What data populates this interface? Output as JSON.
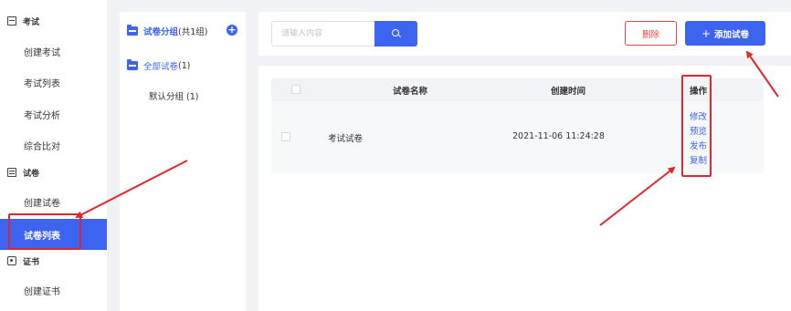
{
  "sidebar": {
    "sections": [
      {
        "title": "考试",
        "icon": "exam-icon",
        "items": [
          "创建考试",
          "考试列表",
          "考试分析",
          "综合比对"
        ]
      },
      {
        "title": "试卷",
        "icon": "paper-icon",
        "items": [
          "创建试卷",
          "试卷列表"
        ]
      },
      {
        "title": "证书",
        "icon": "certificate-icon",
        "items": [
          "创建证书"
        ]
      }
    ],
    "active_item": "试卷列表"
  },
  "groups": {
    "header_label": "试卷分组",
    "header_count": "(共1组)",
    "all_label": "全部试卷",
    "all_count": "(1)",
    "default_group": "默认分组 (1)"
  },
  "toolbar": {
    "search_placeholder": "请输入内容",
    "delete_label": "删除",
    "add_label": "添加试卷",
    "add_icon": "+"
  },
  "table": {
    "columns": [
      "试卷名称",
      "创建时间",
      "操作"
    ],
    "rows": [
      {
        "name": "考试试卷",
        "created": "2021-11-06 11:24:28",
        "actions": [
          "修改",
          "预览",
          "发布",
          "复制"
        ]
      }
    ]
  },
  "colors": {
    "primary": "#3d63f1",
    "danger": "#e64646",
    "annotation": "#e3262b"
  }
}
